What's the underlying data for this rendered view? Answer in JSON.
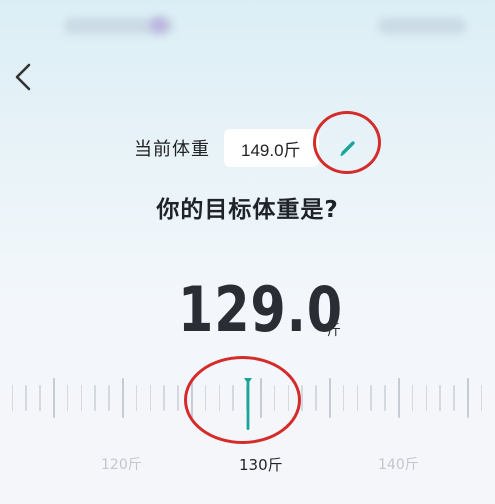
{
  "header": {
    "back_icon": "chevron-left-icon"
  },
  "current_weight": {
    "label": "当前体重",
    "value": "149.0斤",
    "edit_icon": "pencil-icon"
  },
  "question": "你的目标体重是?",
  "target_weight": {
    "value": "129.0",
    "unit": "斤"
  },
  "ruler": {
    "labels": [
      "120斤",
      "130斤",
      "140斤"
    ],
    "selected_label": "130斤",
    "selected_value": 129.0,
    "indicator_color": "#1aa59a"
  },
  "colors": {
    "accent": "#1aa59a",
    "annotation_circle": "#d42b2b"
  }
}
